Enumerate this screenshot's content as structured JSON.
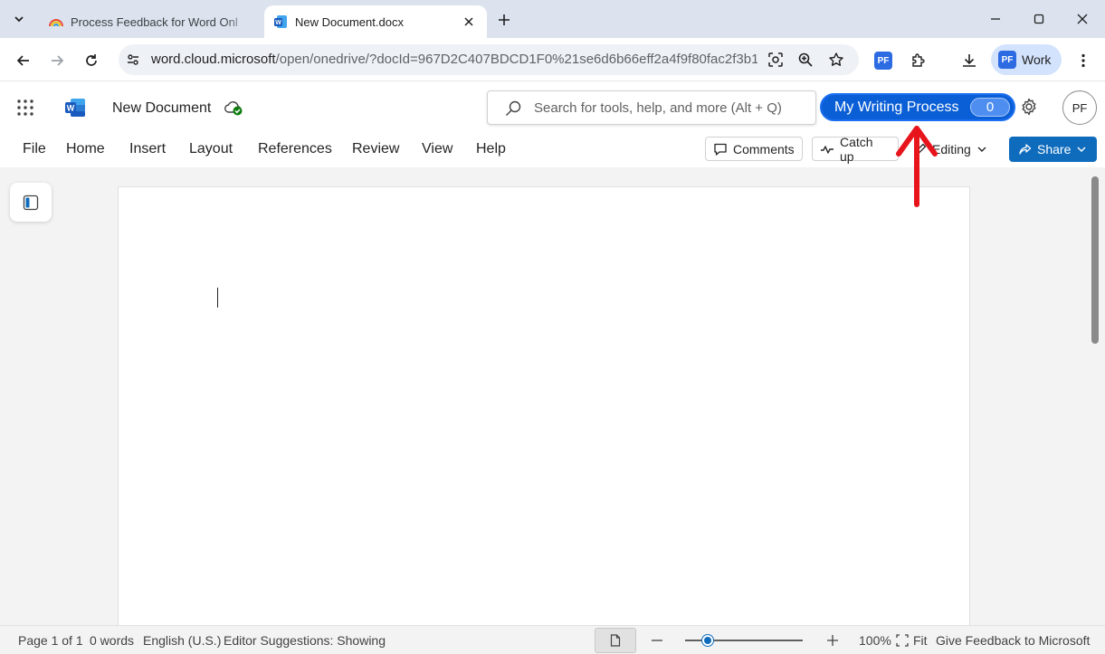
{
  "browser": {
    "tabs": [
      {
        "title": "Process Feedback for Word Onl",
        "favicon": "rainbow-icon",
        "active": false
      },
      {
        "title": "New Document.docx",
        "favicon": "word-icon",
        "active": true
      }
    ],
    "address": {
      "host": "word.cloud.microsoft",
      "path": "/open/onedrive/?docId=967D2C407BDCD1F0%21se6d6b66eff2a4f9f80fac2f3b1..."
    },
    "profile_label": "Work",
    "profile_badge": "PF"
  },
  "word": {
    "doc_title": "New Document",
    "search_placeholder": "Search for tools, help, and more (Alt + Q)",
    "writing_process_label": "My Writing Process",
    "writing_process_count": "0",
    "avatar_initials": "PF",
    "menu": [
      "File",
      "Home",
      "Insert",
      "Layout",
      "References",
      "Review",
      "View",
      "Help"
    ],
    "comments_label": "Comments",
    "catchup_label": "Catch up",
    "editing_label": "Editing",
    "share_label": "Share"
  },
  "status": {
    "page": "Page 1 of 1",
    "words": "0 words",
    "language": "English (U.S.)",
    "editor": "Editor Suggestions: Showing",
    "zoom": "100%",
    "fit": "Fit",
    "feedback": "Give Feedback to Microsoft",
    "zoom_level": 0.2
  },
  "colors": {
    "accent": "#0f6cbd",
    "writing_process": "#0b5fd6",
    "annotation": "#e8141b"
  }
}
